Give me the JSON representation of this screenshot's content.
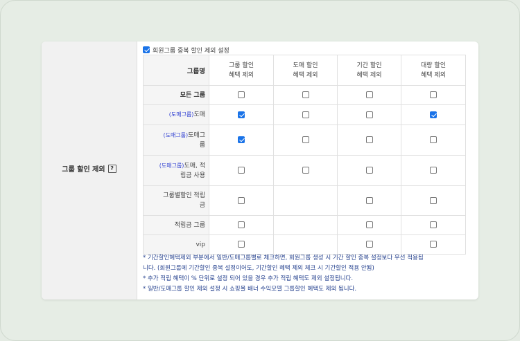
{
  "section": {
    "label": "그룹 할인 제외",
    "help_icon": "?"
  },
  "top_checkbox": {
    "label": "회원그룹 중복 할인 제외 설정",
    "checked": true
  },
  "table": {
    "group_header": "그룹명",
    "columns": [
      {
        "line1": "그룹 할인",
        "line2": "혜택 제외"
      },
      {
        "line1": "도매 할인",
        "line2": "혜택 제외"
      },
      {
        "line1": "기간 할인",
        "line2": "혜택 제외"
      },
      {
        "line1": "대량 할인",
        "line2": "혜택 제외"
      }
    ],
    "rows": [
      {
        "tag": "",
        "line1": "모든 그룹",
        "line2": "",
        "bold": true,
        "checks": [
          false,
          false,
          false,
          false
        ]
      },
      {
        "tag": "(도매그룹)",
        "line1": "도매",
        "line2": "",
        "bold": false,
        "checks": [
          true,
          false,
          false,
          true
        ]
      },
      {
        "tag": "(도매그룹)",
        "line1": "도매그",
        "line2": "룹",
        "bold": false,
        "checks": [
          true,
          false,
          false,
          false
        ]
      },
      {
        "tag": "(도매그룹)",
        "line1": "도매, 적",
        "line2": "립금 사용",
        "bold": false,
        "checks": [
          false,
          false,
          false,
          false
        ]
      },
      {
        "tag": "",
        "line1": "그룹별할인 적립",
        "line2": "금",
        "bold": false,
        "checks": [
          false,
          null,
          false,
          false
        ]
      },
      {
        "tag": "",
        "line1": "적립금 그룹",
        "line2": "",
        "bold": false,
        "checks": [
          false,
          null,
          false,
          false
        ]
      },
      {
        "tag": "",
        "line1": "vip",
        "line2": "",
        "bold": false,
        "checks": [
          false,
          null,
          false,
          false
        ]
      }
    ]
  },
  "notes": [
    "* 기간할인혜택제외 부분에서 일반/도매그룹별로 체크하면, 회원그룹 생성 시 기간 할인 중복 설정보다 우선 적용됩",
    "니다. (회원그룹에 기간할인 중복 설정이어도, 기간할인 혜택 제외 체크 시 기간할인 적용 안됨)",
    "* 추가 적립 혜택이 % 단위로 설정 되어 있을 경우 추가 적립 혜택도 제외 설정됩니다.",
    "* 일반/도매그룹 할인 제외 설정 시 쇼핑몰 배너 수익모델 그룹할인 혜택도 제외 됩니다."
  ],
  "colors": {
    "accent": "#1a73e8",
    "tag": "#2b3bd1",
    "notes": "#24408e"
  }
}
